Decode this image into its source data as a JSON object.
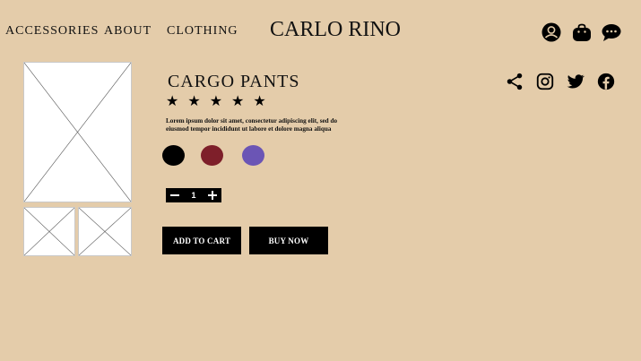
{
  "nav": {
    "links": [
      "ACCESSORIES",
      "ABOUT",
      "CLOTHING"
    ]
  },
  "brand": "CARLO RINO",
  "header_icons": [
    "user-icon",
    "shopping-bag-icon",
    "chat-icon"
  ],
  "product": {
    "title": "CARGO PANTS",
    "rating": 5,
    "rating_max": 5,
    "description": "Lorem ipsum dolor sit amet, consectetur adipiscing elit, sed do eiusmod tempor incididunt ut labore et dolore magna aliqua",
    "colors": [
      "#000000",
      "#7e1f2a",
      "#6b55b5"
    ],
    "quantity": "1",
    "add_to_cart_label": "ADD TO CART",
    "buy_now_label": "BUY NOW"
  },
  "social_icons": [
    "share-icon",
    "instagram-icon",
    "twitter-icon",
    "facebook-icon"
  ],
  "colors": {
    "background": "#e4ccaa",
    "button": "#000000",
    "button_text": "#ffffff"
  }
}
